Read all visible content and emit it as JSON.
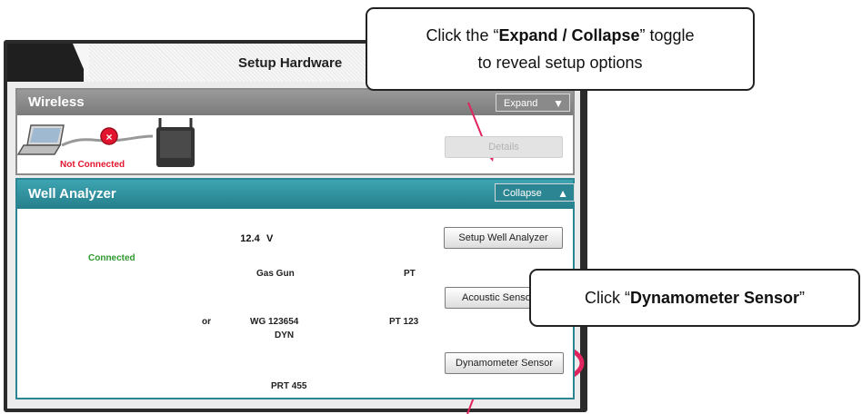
{
  "window": {
    "title": "Setup Hardware"
  },
  "wireless": {
    "title": "Wireless",
    "toggle_label": "Expand",
    "status": "Not Connected",
    "details_label": "Details"
  },
  "well_analyzer": {
    "title": "Well Analyzer",
    "toggle_label": "Collapse",
    "status": "Connected",
    "battery": "12.4",
    "battery_unit": "V",
    "setup_label": "Setup Well Analyzer",
    "acoustic_label": "Acoustic Sensor",
    "dynamometer_label": "Dynamometer Sensor",
    "gas_gun_label": "Gas Gun",
    "gas_gun_id": "WG 123654",
    "pt_label": "PT",
    "pt_id": "PT 123",
    "or_label": "or",
    "dyn_label": "DYN",
    "dyn_id": "PRT 455"
  },
  "callouts": {
    "top_pre": "Click the “",
    "top_bold": "Expand / Collapse",
    "top_post": "” toggle",
    "top_line2": "to reveal setup options",
    "right_pre": "Click “",
    "right_bold": "Dynamometer Sensor",
    "right_post": "”"
  },
  "colors": {
    "highlight": "#e0245e",
    "teal": "#2c8592",
    "battery": "#2eab3c"
  }
}
